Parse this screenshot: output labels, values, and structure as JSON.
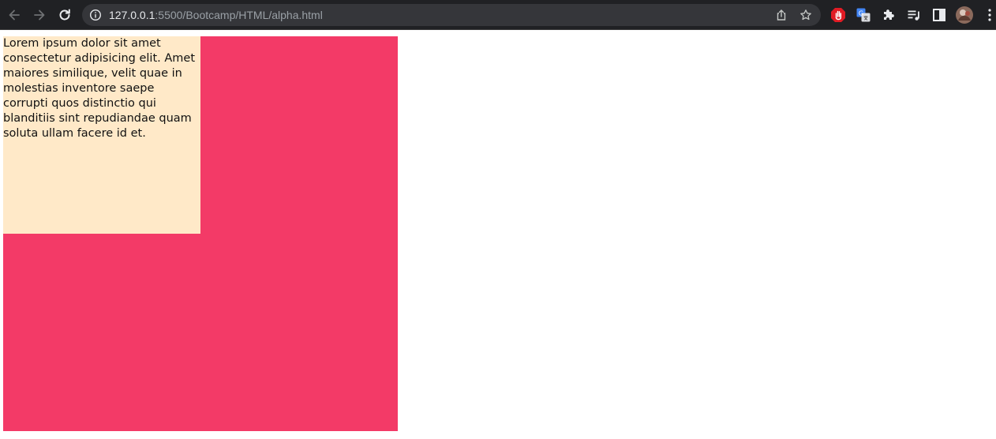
{
  "browser": {
    "url_host": "127.0.0.1",
    "url_path": ":5500/Bootcamp/HTML/alpha.html",
    "icons": {
      "back": "arrow-left-icon",
      "forward": "arrow-right-icon",
      "reload": "reload-icon",
      "site_info": "info-icon",
      "share": "share-icon",
      "bookmark": "star-icon",
      "adblock": "hand-stop-icon",
      "translate": "google-translate-icon",
      "extensions": "puzzle-icon",
      "media": "media-queue-icon",
      "side_panel": "side-panel-icon",
      "profile": "avatar",
      "menu": "kebab-menu-icon"
    }
  },
  "page": {
    "paragraph": "Lorem ipsum dolor sit amet consectetur adipisicing elit. Amet maiores similique, velit quae in molestias inventore saepe corrupti quos distinctio qui blanditiis sint repudiandae quam soluta ullam facere id et.",
    "colors": {
      "outer_box": "#f33a67",
      "inner_box": "#ffe9c8"
    }
  }
}
